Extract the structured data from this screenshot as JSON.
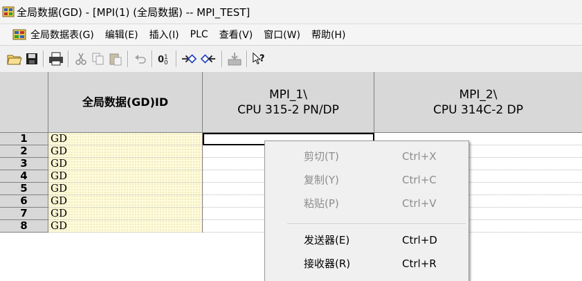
{
  "window": {
    "title": "全局数据(GD) - [MPI(1) (全局数据) -- MPI_TEST]"
  },
  "menubar": {
    "items": [
      "全局数据表(G)",
      "编辑(E)",
      "插入(I)",
      "PLC",
      "查看(V)",
      "窗口(W)",
      "帮助(H)"
    ]
  },
  "toolbar": {
    "icons": [
      "open-folder-icon",
      "save-icon",
      "print-icon",
      "cut-icon",
      "copy-icon",
      "paste-icon",
      "undo-icon",
      "compile-icon",
      "sender-icon",
      "receiver-icon",
      "download-icon",
      "help-icon"
    ]
  },
  "table": {
    "headers": {
      "gd_id": "全局数据(GD)ID",
      "col1_line1": "MPI_1\\",
      "col1_line2": "CPU 315-2 PN/DP",
      "col2_line1": "MPI_2\\",
      "col2_line2": "CPU 314C-2 DP"
    },
    "rows": [
      {
        "num": "1",
        "gd": "GD"
      },
      {
        "num": "2",
        "gd": "GD"
      },
      {
        "num": "3",
        "gd": "GD"
      },
      {
        "num": "4",
        "gd": "GD"
      },
      {
        "num": "5",
        "gd": "GD"
      },
      {
        "num": "6",
        "gd": "GD"
      },
      {
        "num": "7",
        "gd": "GD"
      },
      {
        "num": "8",
        "gd": "GD"
      }
    ],
    "selected_row": 1
  },
  "context_menu": {
    "items": [
      {
        "label": "剪切(T)",
        "shortcut": "Ctrl+X",
        "enabled": false
      },
      {
        "label": "复制(Y)",
        "shortcut": "Ctrl+C",
        "enabled": false
      },
      {
        "label": "粘贴(P)",
        "shortcut": "Ctrl+V",
        "enabled": false
      },
      {
        "label": "发送器(E)",
        "shortcut": "Ctrl+D",
        "enabled": true
      },
      {
        "label": "接收器(R)",
        "shortcut": "Ctrl+R",
        "enabled": true
      }
    ]
  },
  "colors": {
    "header_bg": "#d8d8d8",
    "gd_cell_bg": "#fffbdc",
    "menu_bg": "#f0f0f0",
    "disabled_text": "#8c8c8c"
  }
}
